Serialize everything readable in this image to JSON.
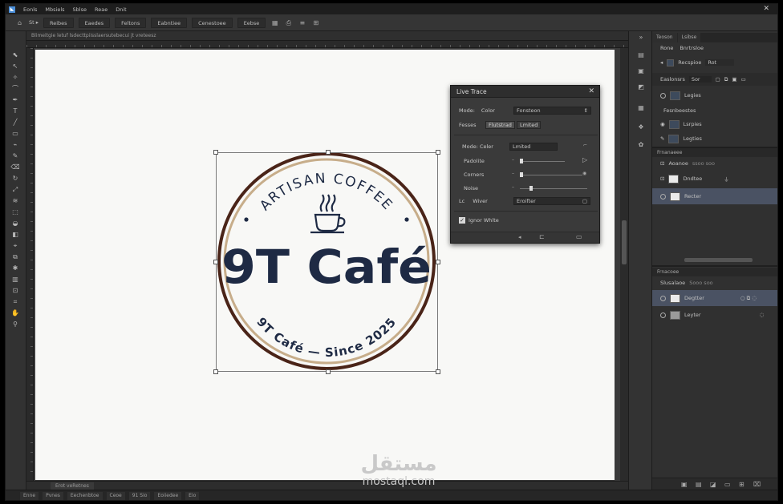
{
  "menubar": {
    "items": [
      "Eonls",
      "Mbsiels",
      "Sblse",
      "Reae",
      "Dnit"
    ]
  },
  "optionsbar": {
    "buttons": [
      "Reibes",
      "Eaedes",
      "Feltons",
      "Eabntiee",
      "Cenestoee",
      "Eebse"
    ],
    "prefix": "St ▸"
  },
  "document": {
    "tab_label": "Blimeitgie letuf lsdecttpiisslaersutebecui jt vreteesz"
  },
  "logo": {
    "top_text": "ARTISAN COFFEE",
    "main_text": "9T Café",
    "bottom_text": "9T Café — Since 2025",
    "colors": {
      "ring_dark": "#4a2418",
      "ring_tan": "#c7ad8a",
      "text": "#1e2a44"
    }
  },
  "live_trace": {
    "title": "Live Trace",
    "mode_label": "Mode:",
    "mode_type": "Color",
    "mode_value": "Fonsteon",
    "preset_label": "Fesses",
    "preset_option_1": "Flutstrad",
    "preset_option_2": "Lmited",
    "mode2_label": "Mode: Celer",
    "mode2_value": "Lmited",
    "palette_label": "Padolite",
    "corners_label": "Corners",
    "noise_label": "Noise",
    "weaver_prefix": "Lc",
    "weaver_label": "Wiver",
    "weaver_value": "Eroifter",
    "ignore_white_label": "Ignor Whlte"
  },
  "panels": {
    "top_tabs": [
      "Teoson",
      "Lsibse"
    ],
    "subtabs": [
      "Rone",
      "Bnrtrsloe"
    ],
    "search_label": "Recspioe",
    "search_value": "Rot",
    "layer_ctrl_label": "Easlonsrs",
    "layer_ctrl_value": "Sor",
    "layers_a": [
      {
        "name": "Legies"
      },
      {
        "name": "Lsrpies"
      },
      {
        "name": "Legties"
      }
    ],
    "section_label": "Fesnbeestes",
    "group2_title": "Frnanaeee",
    "group2_sub": "Aoanoe",
    "group2_sub_val": "ssoo soo",
    "layers_b": [
      {
        "name": "Dndtee"
      },
      {
        "name": "Recter"
      }
    ],
    "group3_title": "Frnacoee",
    "group3_sub": "Slusalaoe",
    "group3_sub_val": "Sooo soo",
    "layers_c": [
      {
        "name": "Degtter"
      },
      {
        "name": "Leyter"
      }
    ]
  },
  "statusbar": {
    "items": [
      "Enne",
      "Pvnes",
      "Eechenbtoe",
      "Ceoe",
      "91 Sio",
      "Eoiiedee",
      "Eio"
    ]
  },
  "hscroll": {
    "label": "Erot veRetnes"
  },
  "watermark": {
    "arabic": "مستقل",
    "latin": "mostaql.com"
  }
}
